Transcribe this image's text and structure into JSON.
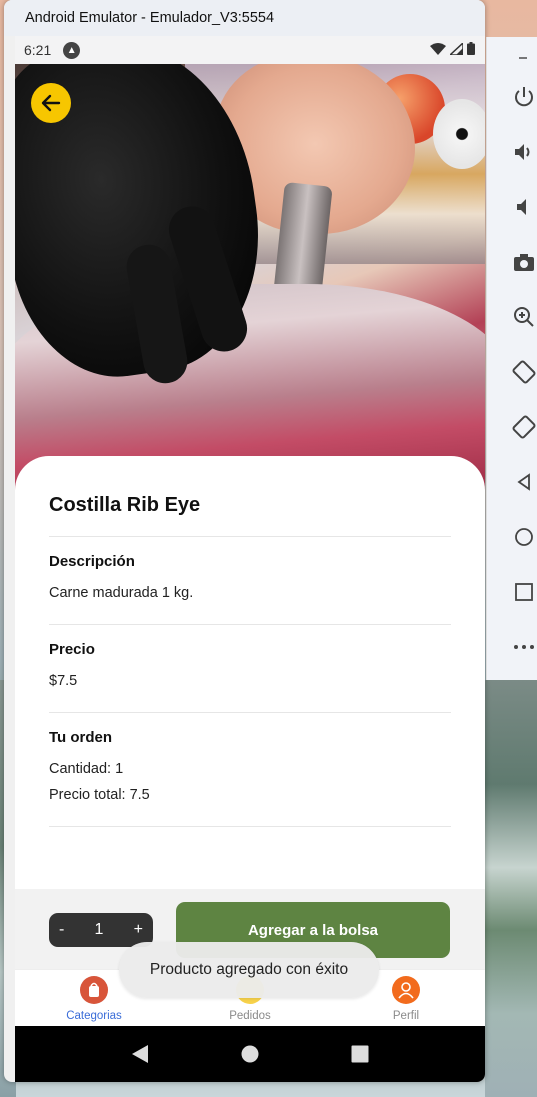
{
  "window": {
    "title": "Android Emulator - Emulador_V3:5554"
  },
  "statusbar": {
    "time": "6:21"
  },
  "product": {
    "title": "Costilla Rib Eye",
    "description_label": "Descripción",
    "description": "Carne madurada 1 kg.",
    "price_label": "Precio",
    "price": "$7.5",
    "order_label": "Tu orden",
    "quantity_text": "Cantidad: 1",
    "total_text": "Precio total: 7.5"
  },
  "actions": {
    "minus_label": "-",
    "quantity": "1",
    "plus_label": "+",
    "add_label": "Agregar a la bolsa"
  },
  "toast": {
    "message": "Producto agregado con éxito"
  },
  "bottom_nav": {
    "items": [
      {
        "label": "Categorias",
        "icon": "bag-icon",
        "active": true,
        "color": "#3b6dd8"
      },
      {
        "label": "Pedidos",
        "icon": "orders-icon",
        "active": false
      },
      {
        "label": "Perfil",
        "icon": "user-icon",
        "active": false
      }
    ]
  },
  "colors": {
    "accent_yellow": "#f7c600",
    "button_green": "#5e8442",
    "stepper_dark": "#333333",
    "profile_orange": "#f26b1d"
  },
  "side_toolbar": {
    "icons": [
      "minimize-icon",
      "power-icon",
      "volume-up-icon",
      "volume-down-icon",
      "camera-icon",
      "zoom-icon",
      "rotate-left-icon",
      "rotate-right-icon",
      "back-icon",
      "home-icon",
      "overview-icon",
      "more-icon"
    ]
  }
}
